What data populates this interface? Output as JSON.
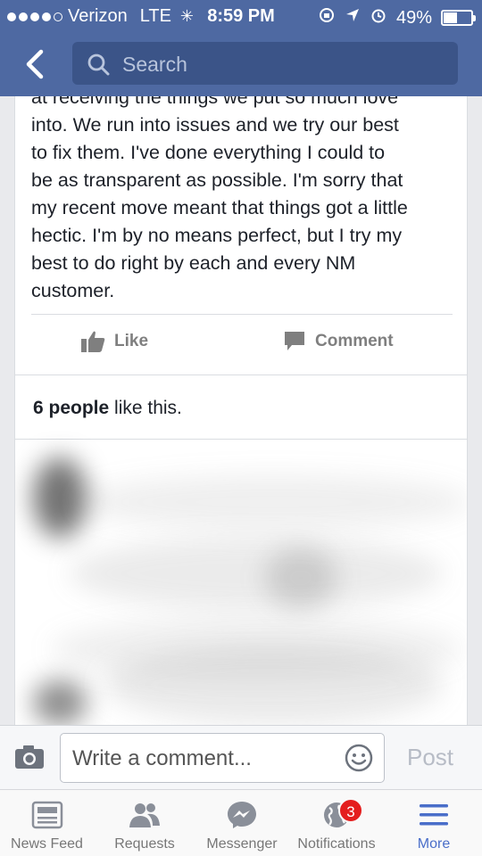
{
  "status_bar": {
    "carrier": "Verizon",
    "network": "LTE",
    "time": "8:59 PM",
    "battery": "49%",
    "battery_level": 0.49
  },
  "nav": {
    "back_icon": "chevron-left-icon",
    "search_placeholder": "Search"
  },
  "post": {
    "lines": [
      "at receiving the things we put so much love",
      "into. We run into issues and we try our best",
      "to fix them. I've done everything I could to",
      "be as transparent as possible. I'm sorry that",
      "my recent move meant that things got a little",
      "hectic. I'm by no means perfect, but I try my",
      "best to do right by each and every NM",
      "customer."
    ],
    "like_label": "Like",
    "comment_label": "Comment",
    "likes_count": "6 people",
    "likes_suffix": " like this."
  },
  "composer": {
    "placeholder": "Write a comment...",
    "post_label": "Post"
  },
  "tabs": [
    {
      "label": "News Feed",
      "icon": "news-feed-icon"
    },
    {
      "label": "Requests",
      "icon": "friend-requests-icon"
    },
    {
      "label": "Messenger",
      "icon": "messenger-icon"
    },
    {
      "label": "Notifications",
      "icon": "globe-icon",
      "badge": "3"
    },
    {
      "label": "More",
      "icon": "menu-icon"
    }
  ],
  "colors": {
    "header": "#4e69a2",
    "accent": "#4a6ec9",
    "badge": "#e41e1e"
  }
}
